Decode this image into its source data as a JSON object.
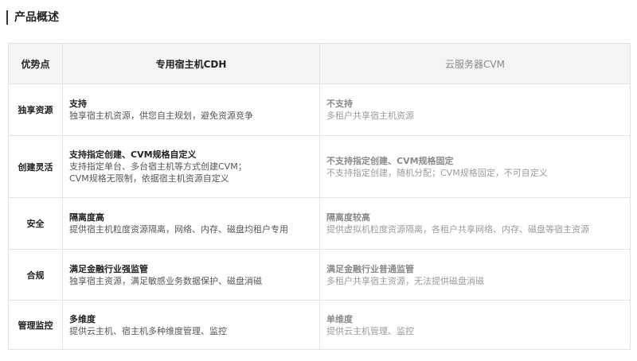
{
  "section": {
    "title": "产品概述"
  },
  "table": {
    "headers": {
      "advantage": "优势点",
      "cdh": "专用宿主机CDH",
      "cvm": "云服务器CVM"
    },
    "rows": [
      {
        "advantage": "独享资源",
        "cdh": {
          "title": "支持",
          "lines": [
            "独享宿主机资源，供您自主规划，避免资源竞争"
          ]
        },
        "cvm": {
          "title": "不支持",
          "lines": [
            "多租户共享宿主机资源"
          ]
        }
      },
      {
        "advantage": "创建灵活",
        "cdh": {
          "title": "支持指定创建、CVM规格自定义",
          "lines": [
            "支持指定单台、多台宿主机等方式创建CVM；",
            "CVM规格无限制，依据宿主机资源自定义"
          ]
        },
        "cvm": {
          "title": "不支持指定创建、CVM规格固定",
          "lines": [
            "不支持指定创建，随机分配；CVM规格固定，不可自定义"
          ]
        }
      },
      {
        "advantage": "安全",
        "cdh": {
          "title": "隔离度高",
          "lines": [
            "提供宿主机粒度资源隔离，网络、内存、磁盘均租户专用"
          ]
        },
        "cvm": {
          "title": "隔离度较高",
          "lines": [
            "提供虚拟机粒度资源隔离，各租户共享网络、内存、磁盘等宿主资源"
          ]
        }
      },
      {
        "advantage": "合规",
        "cdh": {
          "title": "满足金融行业强监管",
          "lines": [
            "独享宿主资源，满足敏感业务数据保护、磁盘消磁"
          ]
        },
        "cvm": {
          "title": "满足金融行业普通监管",
          "lines": [
            "多租户共享宿主资源，无法提供磁盘消磁"
          ]
        }
      },
      {
        "advantage": "管理监控",
        "cdh": {
          "title": "多维度",
          "lines": [
            "提供云主机、宿主机多种维度管理、监控"
          ]
        },
        "cvm": {
          "title": "单维度",
          "lines": [
            "提供云主机管理、监控"
          ]
        }
      }
    ]
  }
}
